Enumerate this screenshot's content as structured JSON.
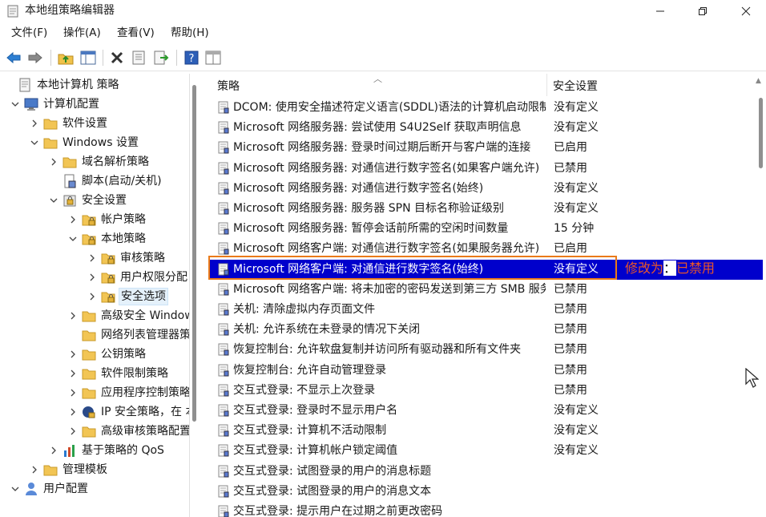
{
  "window": {
    "title": "本地组策略编辑器",
    "minimize_icon": "minimize-icon",
    "maximize_icon": "maximize-icon",
    "close_icon": "close-icon"
  },
  "menu": [
    "文件(F)",
    "操作(A)",
    "查看(V)",
    "帮助(H)"
  ],
  "toolbar": [
    "back-arrow-icon",
    "forward-arrow-icon",
    "up-folder-icon",
    "show-hide-tree-icon",
    "delete-icon",
    "properties-icon",
    "export-list-icon",
    "help-icon",
    "extended-view-icon"
  ],
  "tree": [
    {
      "label": "本地计算机 策略",
      "icon": "policy-document-icon",
      "arrow": ""
    },
    {
      "label": "计算机配置",
      "icon": "computer-icon",
      "arrow": "down"
    },
    {
      "label": "软件设置",
      "icon": "folder-icon",
      "arrow": "right"
    },
    {
      "label": "Windows 设置",
      "icon": "folder-icon",
      "arrow": "down"
    },
    {
      "label": "域名解析策略",
      "icon": "folder-icon",
      "arrow": "right"
    },
    {
      "label": "脚本(启动/关机)",
      "icon": "script-icon",
      "arrow": ""
    },
    {
      "label": "安全设置",
      "icon": "security-icon",
      "arrow": "down"
    },
    {
      "label": "帐户策略",
      "icon": "locked-folder-icon",
      "arrow": "right"
    },
    {
      "label": "本地策略",
      "icon": "locked-folder-icon",
      "arrow": "down"
    },
    {
      "label": "审核策略",
      "icon": "locked-folder-icon",
      "arrow": "right"
    },
    {
      "label": "用户权限分配",
      "icon": "locked-folder-icon",
      "arrow": "right"
    },
    {
      "label": "安全选项",
      "icon": "locked-folder-icon",
      "arrow": "right",
      "selected": true
    },
    {
      "label": "高级安全 Windows Defender 防火墙",
      "icon": "folder-icon",
      "arrow": "right"
    },
    {
      "label": "网络列表管理器策略",
      "icon": "folder-icon",
      "arrow": ""
    },
    {
      "label": "公钥策略",
      "icon": "folder-icon",
      "arrow": "right"
    },
    {
      "label": "软件限制策略",
      "icon": "folder-icon",
      "arrow": "right"
    },
    {
      "label": "应用程序控制策略",
      "icon": "folder-icon",
      "arrow": "right"
    },
    {
      "label": "IP 安全策略，在 本地计算机",
      "icon": "ip-security-icon",
      "arrow": "right"
    },
    {
      "label": "高级审核策略配置",
      "icon": "folder-icon",
      "arrow": "right"
    },
    {
      "label": "基于策略的 QoS",
      "icon": "qos-chart-icon",
      "arrow": "right"
    },
    {
      "label": "管理模板",
      "icon": "folder-icon",
      "arrow": "right"
    },
    {
      "label": "用户配置",
      "icon": "user-icon",
      "arrow": "down"
    }
  ],
  "list": {
    "columns": [
      "策略",
      "安全设置"
    ],
    "rows": [
      {
        "policy": "DCOM: 使用安全描述符定义语言(SDDL)语法的计算机启动限制",
        "setting": "没有定义"
      },
      {
        "policy": "Microsoft 网络服务器: 尝试使用 S4U2Self 获取声明信息",
        "setting": "没有定义"
      },
      {
        "policy": "Microsoft 网络服务器: 登录时间过期后断开与客户端的连接",
        "setting": "已启用"
      },
      {
        "policy": "Microsoft 网络服务器: 对通信进行数字签名(如果客户端允许)",
        "setting": "已禁用"
      },
      {
        "policy": "Microsoft 网络服务器: 对通信进行数字签名(始终)",
        "setting": "没有定义"
      },
      {
        "policy": "Microsoft 网络服务器: 服务器 SPN 目标名称验证级别",
        "setting": "没有定义"
      },
      {
        "policy": "Microsoft 网络服务器: 暂停会话前所需的空闲时间数量",
        "setting": "15 分钟"
      },
      {
        "policy": "Microsoft 网络客户端: 对通信进行数字签名(如果服务器允许)",
        "setting": "已启用"
      },
      {
        "policy": "Microsoft 网络客户端: 对通信进行数字签名(始终)",
        "setting": "没有定义",
        "highlighted": true
      },
      {
        "policy": "Microsoft 网络客户端: 将未加密的密码发送到第三方 SMB 服务器",
        "setting": "已禁用"
      },
      {
        "policy": "关机: 清除虚拟内存页面文件",
        "setting": "已禁用"
      },
      {
        "policy": "关机: 允许系统在未登录的情况下关闭",
        "setting": "已禁用"
      },
      {
        "policy": "恢复控制台: 允许软盘复制并访问所有驱动器和所有文件夹",
        "setting": "已禁用"
      },
      {
        "policy": "恢复控制台: 允许自动管理登录",
        "setting": "已禁用"
      },
      {
        "policy": "交互式登录: 不显示上次登录",
        "setting": "已禁用"
      },
      {
        "policy": "交互式登录: 登录时不显示用户名",
        "setting": "没有定义"
      },
      {
        "policy": "交互式登录: 计算机不活动限制",
        "setting": "没有定义"
      },
      {
        "policy": "交互式登录: 计算机帐户锁定阈值",
        "setting": "没有定义"
      },
      {
        "policy": "交互式登录: 试图登录的用户的消息标题",
        "setting": ""
      },
      {
        "policy": "交互式登录: 试图登录的用户的消息文本",
        "setting": ""
      },
      {
        "policy": "交互式登录: 提示用户在过期之前更改密码",
        "setting": ""
      }
    ]
  },
  "annotation": {
    "part1": "修改为",
    "gap": "：",
    "part2": "已禁用"
  },
  "colors": {
    "highlight": "#0000cc",
    "annotation": "#e8562a",
    "box": "#ea7a19"
  }
}
